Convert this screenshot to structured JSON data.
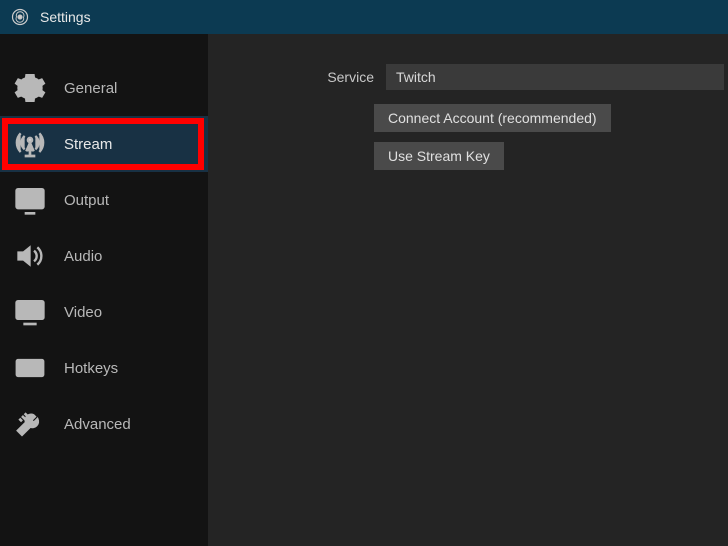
{
  "window": {
    "title": "Settings"
  },
  "sidebar": {
    "items": [
      {
        "label": "General",
        "icon": "gear-icon",
        "selected": false,
        "highlight": false
      },
      {
        "label": "Stream",
        "icon": "antenna-icon",
        "selected": true,
        "highlight": true
      },
      {
        "label": "Output",
        "icon": "output-icon",
        "selected": false,
        "highlight": false
      },
      {
        "label": "Audio",
        "icon": "speaker-icon",
        "selected": false,
        "highlight": false
      },
      {
        "label": "Video",
        "icon": "monitor-icon",
        "selected": false,
        "highlight": false
      },
      {
        "label": "Hotkeys",
        "icon": "keyboard-icon",
        "selected": false,
        "highlight": false
      },
      {
        "label": "Advanced",
        "icon": "tools-icon",
        "selected": false,
        "highlight": false
      }
    ]
  },
  "panel": {
    "service_label": "Service",
    "service_value": "Twitch",
    "connect_button": "Connect Account (recommended)",
    "streamkey_button": "Use Stream Key"
  }
}
